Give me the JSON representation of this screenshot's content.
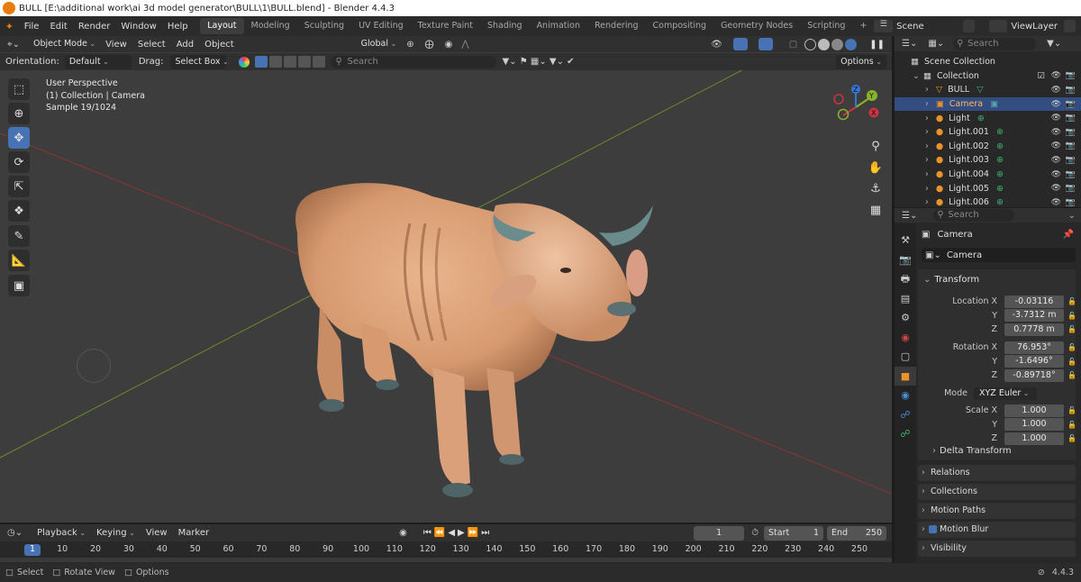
{
  "window": {
    "title": "BULL [E:\\additional work\\ai 3d model generator\\BULL\\1\\BULL.blend] - Blender 4.4.3"
  },
  "menu": {
    "items": [
      "File",
      "Edit",
      "Render",
      "Window",
      "Help"
    ]
  },
  "workspaces": {
    "tabs": [
      "Layout",
      "Modeling",
      "Sculpting",
      "UV Editing",
      "Texture Paint",
      "Shading",
      "Animation",
      "Rendering",
      "Compositing",
      "Geometry Nodes",
      "Scripting"
    ],
    "active": "Layout",
    "add": "+"
  },
  "scene": {
    "label": "Scene",
    "viewlayer": "ViewLayer"
  },
  "viewport": {
    "mode": "Object Mode",
    "menus": [
      "View",
      "Select",
      "Add",
      "Object"
    ],
    "transform_space": "Global",
    "orientation_label": "Orientation:",
    "orientation_value": "Default",
    "drag_label": "Drag:",
    "drag_value": "Select Box",
    "search_placeholder": "Search",
    "options": "Options",
    "info_line1": "User Perspective",
    "info_line2": "(1) Collection | Camera",
    "info_line3": "Sample 19/1024",
    "gizmo": {
      "x": "X",
      "y": "Y",
      "z": "Z"
    }
  },
  "outliner": {
    "search_placeholder": "Search",
    "root": "Scene Collection",
    "collection": "Collection",
    "items": [
      {
        "name": "BULL",
        "selected": false
      },
      {
        "name": "Camera",
        "selected": true
      },
      {
        "name": "Light",
        "selected": false
      },
      {
        "name": "Light.001",
        "selected": false
      },
      {
        "name": "Light.002",
        "selected": false
      },
      {
        "name": "Light.003",
        "selected": false
      },
      {
        "name": "Light.004",
        "selected": false
      },
      {
        "name": "Light.005",
        "selected": false
      },
      {
        "name": "Light.006",
        "selected": false
      }
    ]
  },
  "properties": {
    "search_placeholder": "Search",
    "object_name": "Camera",
    "datablock": "Camera",
    "transform_title": "Transform",
    "location": {
      "label": "Location X",
      "x": "-0.03116",
      "y": "-3.7312 m",
      "z": "0.7778 m"
    },
    "rotation": {
      "label": "Rotation X",
      "x": "76.953°",
      "y": "-1.6496°",
      "z": "-0.89718°"
    },
    "mode_label": "Mode",
    "mode_value": "XYZ Euler",
    "scale": {
      "label": "Scale X",
      "x": "1.000",
      "y": "1.000",
      "z": "1.000"
    },
    "axis_y": "Y",
    "axis_z": "Z",
    "delta_transform": "Delta Transform",
    "panels": [
      "Relations",
      "Collections",
      "Motion Paths",
      "Motion Blur",
      "Visibility"
    ]
  },
  "timeline": {
    "menus": [
      "Playback",
      "Keying",
      "View",
      "Marker"
    ],
    "current_frame": "1",
    "start_label": "Start",
    "start_value": "1",
    "end_label": "End",
    "end_value": "250",
    "ticks": [
      "1",
      "10",
      "20",
      "30",
      "40",
      "50",
      "60",
      "70",
      "80",
      "90",
      "100",
      "110",
      "120",
      "130",
      "140",
      "150",
      "160",
      "170",
      "180",
      "190",
      "200",
      "210",
      "220",
      "230",
      "240",
      "250"
    ]
  },
  "statusbar": {
    "select": "Select",
    "rotate": "Rotate View",
    "options": "Options",
    "version": "4.4.3"
  }
}
